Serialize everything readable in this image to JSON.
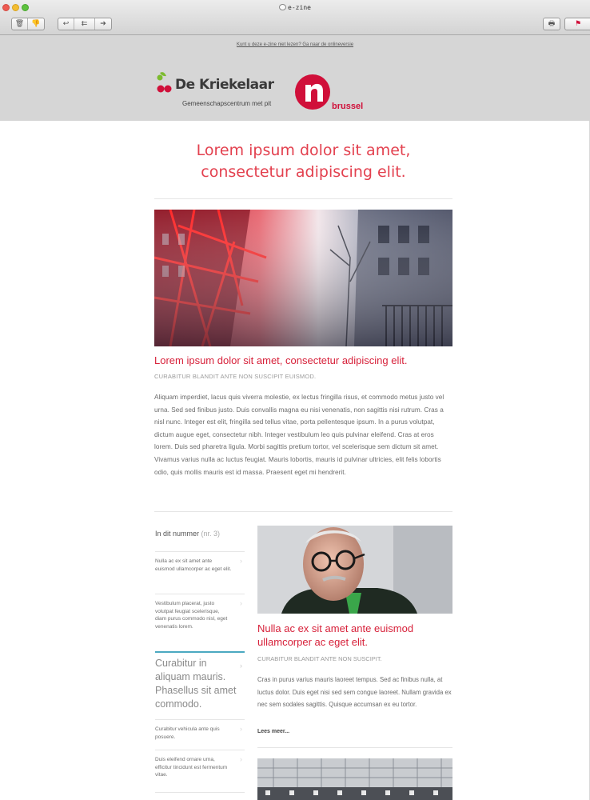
{
  "window": {
    "title": "e-zine",
    "toolbar_left": [
      {
        "icon": "trash-icon",
        "glyph": "🗑"
      },
      {
        "icon": "thumbs-down-icon",
        "glyph": "👎"
      }
    ],
    "toolbar_nav": [
      {
        "icon": "reply-icon",
        "glyph": "↩"
      },
      {
        "icon": "reply-all-icon",
        "glyph": "⇇"
      },
      {
        "icon": "forward-icon",
        "glyph": "➔"
      }
    ],
    "toolbar_right": [
      {
        "icon": "print-icon",
        "glyph": "🖶"
      },
      {
        "icon": "flag-icon",
        "glyph": "⚑"
      }
    ]
  },
  "header": {
    "online_link": "Kunt u deze e-zine niet lezen? Ga naar de onlineversie",
    "logo_primary": "De Kriekelaar",
    "logo_tagline": "Gemeenschapscentrum met pit",
    "logo_secondary": "brussel",
    "brand_colors": {
      "red": "#d0103a",
      "green": "#7cbb2e",
      "grey": "#3a3a3a"
    }
  },
  "main": {
    "headline": "Lorem ipsum dolor sit amet, consectetur adipiscing elit.",
    "featured": {
      "title": "Lorem ipsum dolor sit amet, consectetur adipiscing elit.",
      "kicker": "CURABITUR BLANDIT ANTE NON SUSCIPIT EUISMOD.",
      "body": "Aliquam imperdiet, lacus quis viverra molestie, ex lectus fringilla risus, et commodo metus justo vel urna. Sed sed finibus justo. Duis convallis magna eu nisi venenatis, non sagittis nisi rutrum. Cras a nisl nunc. Integer est elit, fringilla sed tellus vitae, porta pellentesque ipsum. In a purus volutpat, dictum augue eget, consectetur nibh. Integer vestibulum leo quis pulvinar eleifend. Cras at eros lorem. Duis sed pharetra ligula. Morbi sagittis pretium tortor, vel scelerisque sem dictum sit amet. Vivamus varius nulla ac luctus feugiat. Mauris lobortis, mauris id pulvinar ultricies, elit felis lobortis odio, quis mollis mauris est id massa. Praesent eget mi hendrerit."
    },
    "accent_color": "#d7213a"
  },
  "sidebar": {
    "heading": "In dit nummer",
    "issue": "(nr. 3)",
    "items": [
      {
        "label": "Nulla ac ex sit amet ante euismod ullamcorper ac eget elit."
      },
      {
        "label": "Vestibulum placerat, justo volutpat feugiat scelerisque, diam purus commodo nisl, eget venenatis lorem."
      },
      {
        "label": "Curabitur in aliquam mauris. Phasellus sit amet commodo."
      },
      {
        "label": "Curabitur vehicula ante quis posuere."
      },
      {
        "label": "Duis eleifend ornare urna, efficitur tincidunt est fermentum vitae."
      }
    ],
    "active_index": 2,
    "active_color": "#4ba9c1",
    "chevron": "›"
  },
  "article2": {
    "title": "Nulla ac ex sit amet ante euismod ullamcorper ac eget elit.",
    "kicker": "CURABITUR BLANDIT ANTE NON SUSCIPIT.",
    "body": "Cras in purus varius mauris laoreet tempus. Sed ac finibus nulla, at luctus dolor. Duis eget nisi sed sem congue laoreet. Nullam gravida ex nec sem sodales sagittis. Quisque accumsan ex eu tortor.",
    "read_more": "Lees meer..."
  }
}
